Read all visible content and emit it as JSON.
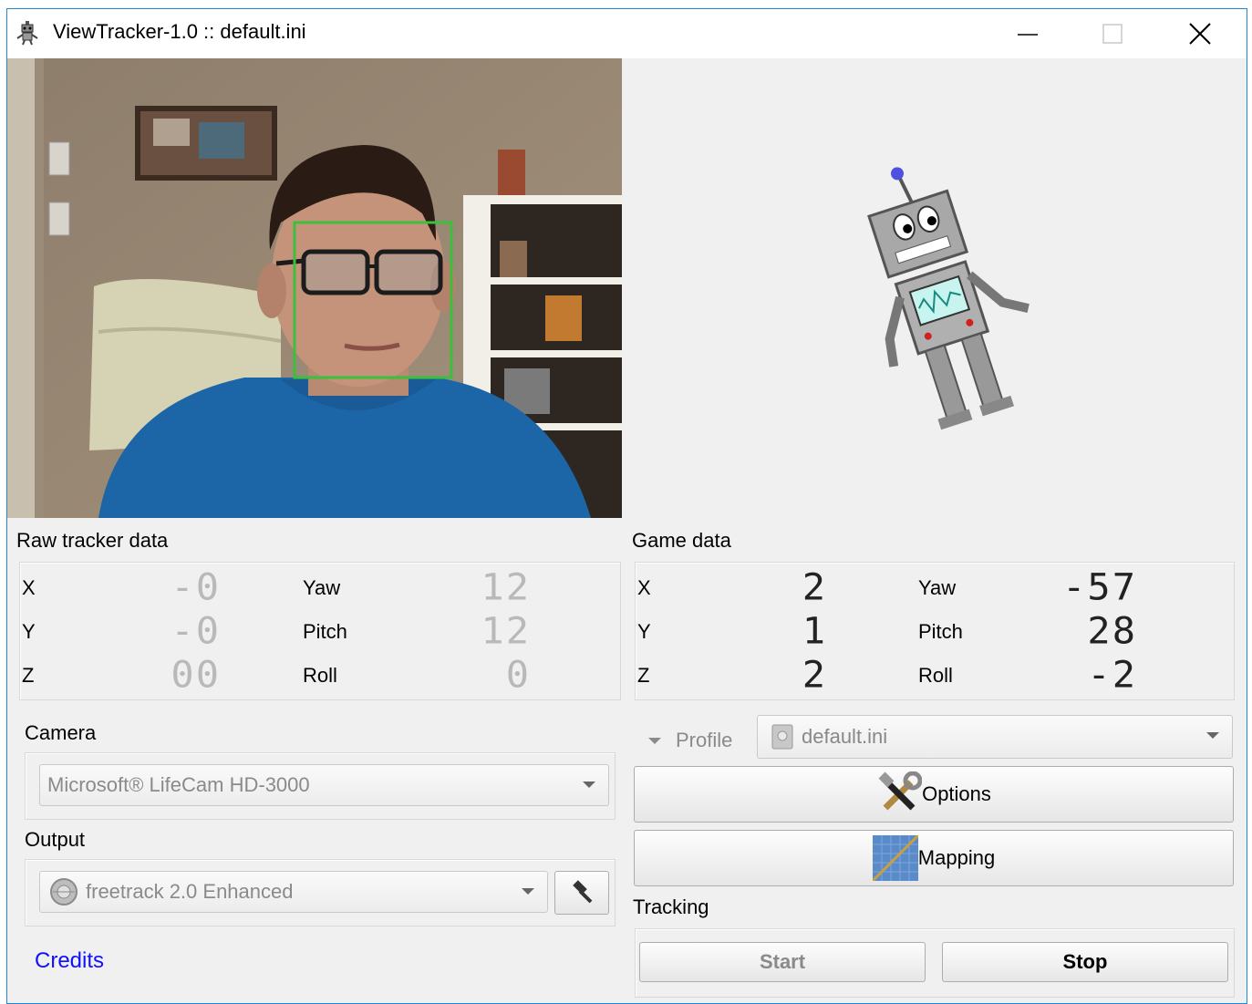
{
  "window": {
    "title": "ViewTracker-1.0 :: default.ini",
    "border_color": "#1e88d8"
  },
  "icons": {
    "app": "robot-icon",
    "minimize": "minimize-icon",
    "maximize": "maximize-icon",
    "close": "close-icon"
  },
  "video": {
    "face_box_color": "#3cbf3c"
  },
  "raw_tracker": {
    "title": "Raw tracker data",
    "rows": [
      {
        "label": "X",
        "value": "-0"
      },
      {
        "label": "Y",
        "value": "-0"
      },
      {
        "label": "Z",
        "value": "00"
      }
    ],
    "rot_rows": [
      {
        "label": "Yaw",
        "value": "12"
      },
      {
        "label": "Pitch",
        "value": "12"
      },
      {
        "label": "Roll",
        "value": "0"
      }
    ]
  },
  "game_data": {
    "title": "Game data",
    "rows": [
      {
        "label": "X",
        "value": "2"
      },
      {
        "label": "Y",
        "value": "1"
      },
      {
        "label": "Z",
        "value": "2"
      }
    ],
    "rot_rows": [
      {
        "label": "Yaw",
        "value": "-57"
      },
      {
        "label": "Pitch",
        "value": "28"
      },
      {
        "label": "Roll",
        "value": "-2"
      }
    ]
  },
  "camera": {
    "label": "Camera",
    "selected": "Microsoft® LifeCam HD-3000"
  },
  "output": {
    "label": "Output",
    "selected": "freetrack 2.0 Enhanced"
  },
  "profile": {
    "label": "Profile",
    "selected": "default.ini"
  },
  "buttons": {
    "options": "Options",
    "mapping": "Mapping",
    "start": "Start",
    "stop": "Stop"
  },
  "tracking": {
    "label": "Tracking"
  },
  "credits": {
    "label": "Credits",
    "color": "#1010ff"
  }
}
